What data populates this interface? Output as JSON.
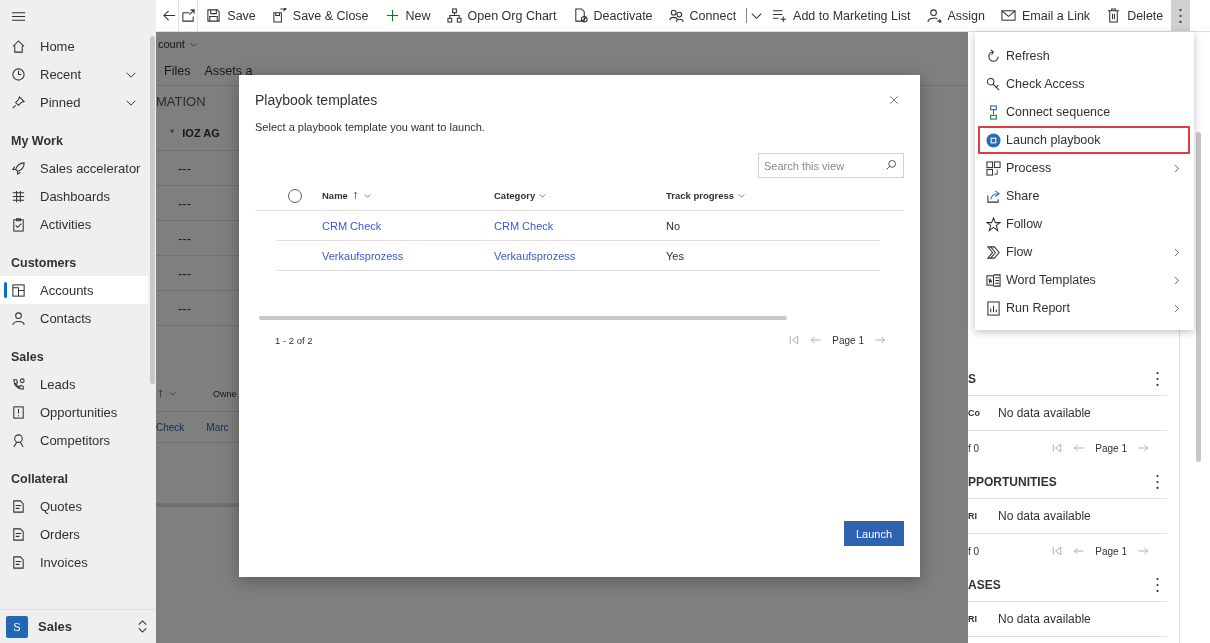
{
  "sidebar": {
    "top": [
      {
        "label": "Home",
        "expandable": false
      },
      {
        "label": "Recent",
        "expandable": true
      },
      {
        "label": "Pinned",
        "expandable": true
      }
    ],
    "groups": [
      {
        "title": "My Work",
        "items": [
          {
            "label": "Sales accelerator",
            "selected": false
          },
          {
            "label": "Dashboards",
            "selected": false
          },
          {
            "label": "Activities",
            "selected": false
          }
        ]
      },
      {
        "title": "Customers",
        "items": [
          {
            "label": "Accounts",
            "selected": true
          },
          {
            "label": "Contacts",
            "selected": false
          }
        ]
      },
      {
        "title": "Sales",
        "items": [
          {
            "label": "Leads",
            "selected": false
          },
          {
            "label": "Opportunities",
            "selected": false
          },
          {
            "label": "Competitors",
            "selected": false
          }
        ]
      },
      {
        "title": "Collateral",
        "items": [
          {
            "label": "Quotes",
            "selected": false
          },
          {
            "label": "Orders",
            "selected": false
          },
          {
            "label": "Invoices",
            "selected": false
          }
        ]
      }
    ],
    "area": {
      "initial": "S",
      "label": "Sales"
    }
  },
  "command_bar": {
    "actions": [
      {
        "label": "Save"
      },
      {
        "label": "Save & Close"
      },
      {
        "label": "New"
      },
      {
        "label": "Open Org Chart"
      },
      {
        "label": "Deactivate"
      },
      {
        "label": "Connect"
      },
      {
        "label": "Add to Marketing List"
      },
      {
        "label": "Assign"
      },
      {
        "label": "Email a Link"
      },
      {
        "label": "Delete"
      }
    ],
    "more_expanded": true
  },
  "more_menu": {
    "items": [
      {
        "label": "Refresh",
        "submenu": false,
        "highlighted": false
      },
      {
        "label": "Check Access",
        "submenu": false,
        "highlighted": false
      },
      {
        "label": "Connect sequence",
        "submenu": false,
        "highlighted": false
      },
      {
        "label": "Launch playbook",
        "submenu": false,
        "highlighted": true
      },
      {
        "label": "Process",
        "submenu": true,
        "highlighted": false
      },
      {
        "label": "Share",
        "submenu": false,
        "highlighted": false
      },
      {
        "label": "Follow",
        "submenu": false,
        "highlighted": false
      },
      {
        "label": "Flow",
        "submenu": true,
        "highlighted": false
      },
      {
        "label": "Word Templates",
        "submenu": true,
        "highlighted": false
      },
      {
        "label": "Run Report",
        "submenu": true,
        "highlighted": false
      }
    ]
  },
  "form": {
    "header": "count",
    "tabs": [
      "Files",
      "Assets a"
    ],
    "section": "MATION",
    "field_value": "IOZ AG",
    "required_mark": "*",
    "empty_values": [
      "---",
      "---",
      "---",
      "---",
      "---"
    ],
    "subgrid": {
      "column": "Owne",
      "cells": [
        "Check",
        "Marc"
      ]
    }
  },
  "side_panel": {
    "sections": [
      {
        "title": "S",
        "column": "Co",
        "empty": "No data available",
        "count": "f 0",
        "page": "Page 1"
      },
      {
        "title": "PPORTUNITIES",
        "column": "RI",
        "empty": "No data available",
        "count": "f 0",
        "page": "Page 1"
      },
      {
        "title": "ASES",
        "column": "RI",
        "empty": "No data available"
      }
    ]
  },
  "dialog": {
    "title": "Playbook templates",
    "subtitle": "Select a playbook template you want to launch.",
    "search": {
      "placeholder": "Search this view"
    },
    "all_checked": false,
    "columns": [
      {
        "label": "Name",
        "sorted": true
      },
      {
        "label": "Category",
        "sorted": false
      },
      {
        "label": "Track progress",
        "sorted": false
      }
    ],
    "rows": [
      {
        "name": "CRM Check",
        "category": "CRM Check",
        "track_progress": "No"
      },
      {
        "name": "Verkaufsprozess",
        "category": "Verkaufsprozess",
        "track_progress": "Yes"
      }
    ],
    "record_count": "1 - 2 of 2",
    "page": "Page 1",
    "launch_button": "Launch"
  }
}
